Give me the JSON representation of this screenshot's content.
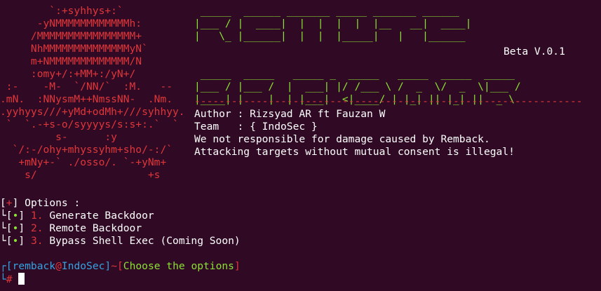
{
  "skull_art": "        `:+syhhys+:`\n      -yNMMMMMMMMMMMMh:\n     /MMMMMMMMMMMMMMMM+\n     NhMMMMMMMMMMMMMMyN`\n     m+NMMMMMMMMMMMMM/N\n     :omy+/:+MM+:/yN+/\n :-    -M-  `/NN/`  :M.   --\n.mN.  :NNysmM++NmssNN-  .Nm.\n.yyhyys///+yMd+odMh+///syhhyy.\n `  `.-+s-o/syyyys/s:s+:.`  `\n         s-      :y\n  `/:-/ohy+mhyssyhm+sho/-:/`\n   +mNy+-` ./osso/. `-+yNm+\n    s/                  +s",
  "banner": {
    "ascii_art": " _____  ______ __  __  ____ _______ ______\n|___ / |  ____|  \\/  |/ __ \\__   __|  ____|\n|  _ \\ | |____| |  | | |__| | | |  | |____\n\n _____  _____   _____ _  _____   ____   ____  _____\n|___ / |___ /  |  ___| |/ /___ \\ / __ \\ / __ \\|___ /\n|____| |    |  | |___|  <|____| | |__| | |__| |  _ \\\n",
    "version": "Beta V.0.1"
  },
  "divider": "---------------------------------------------------------------",
  "info": {
    "author": "Author : Rizsyad AR ft Fauzan W",
    "team": "Team   : { IndoSec }",
    "disclaimer": "We not responsible for damage caused by Remback.",
    "warning": "Attacking targets without mutual consent is illegal!"
  },
  "options": {
    "header_mark": "+",
    "header_label": " Options :",
    "bullet": "•",
    "items": [
      {
        "number": "1.",
        "label": "Generate Backdoor"
      },
      {
        "number": "2.",
        "label": "Remote Backdoor"
      },
      {
        "number": "3.",
        "label": "Bypass Shell Exec (Coming Soon)"
      }
    ]
  },
  "prompt": {
    "user": "remback",
    "at": "@",
    "host": "IndoSec",
    "tilde": "~",
    "message": "Choose the options",
    "symbol": "#"
  },
  "colors": {
    "background": "#300a24",
    "red": "#e0363a",
    "green": "#8ae234",
    "blue": "#34a3e2",
    "white": "#ffffff"
  }
}
